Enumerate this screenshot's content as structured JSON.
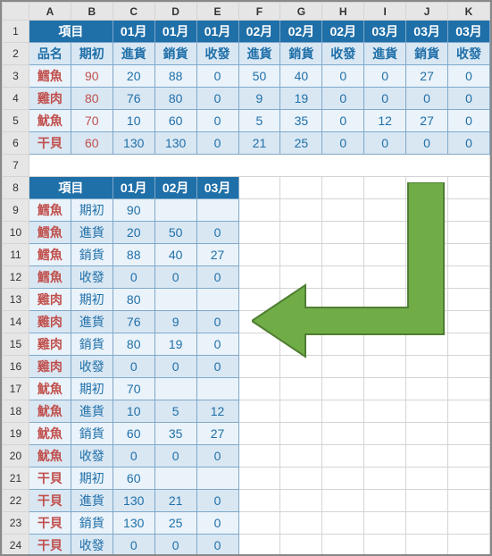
{
  "cols": [
    "A",
    "B",
    "C",
    "D",
    "E",
    "F",
    "G",
    "H",
    "I",
    "J",
    "K"
  ],
  "rows": [
    "1",
    "2",
    "3",
    "4",
    "5",
    "6",
    "7",
    "8",
    "9",
    "10",
    "11",
    "12",
    "13",
    "14",
    "15",
    "16",
    "17",
    "18",
    "19",
    "20",
    "21",
    "22",
    "23",
    "24"
  ],
  "top": {
    "h1": {
      "item": "項目",
      "m1": "01月",
      "m2": "01月",
      "m3": "01月",
      "m4": "02月",
      "m5": "02月",
      "m6": "02月",
      "m7": "03月",
      "m8": "03月",
      "m9": "03月"
    },
    "h2": {
      "c1": "品名",
      "c2": "期初",
      "c3": "進貨",
      "c4": "銷貨",
      "c5": "收發",
      "c6": "進貨",
      "c7": "銷貨",
      "c8": "收發",
      "c9": "進貨",
      "c10": "銷貨",
      "c11": "收發"
    },
    "r": [
      {
        "n": "鱈魚",
        "i": "90",
        "v": [
          "20",
          "88",
          "0",
          "50",
          "40",
          "0",
          "0",
          "27",
          "0"
        ]
      },
      {
        "n": "雞肉",
        "i": "80",
        "v": [
          "76",
          "80",
          "0",
          "9",
          "19",
          "0",
          "0",
          "0",
          "0"
        ]
      },
      {
        "n": "魷魚",
        "i": "70",
        "v": [
          "10",
          "60",
          "0",
          "5",
          "35",
          "0",
          "12",
          "27",
          "0"
        ]
      },
      {
        "n": "干貝",
        "i": "60",
        "v": [
          "130",
          "130",
          "0",
          "21",
          "25",
          "0",
          "0",
          "0",
          "0"
        ]
      }
    ]
  },
  "small": {
    "h": {
      "item": "項目",
      "m1": "01月",
      "m2": "02月",
      "m3": "03月"
    },
    "r": [
      {
        "n": "鱈魚",
        "t": "期初",
        "v": [
          "90",
          "",
          ""
        ]
      },
      {
        "n": "鱈魚",
        "t": "進貨",
        "v": [
          "20",
          "50",
          "0"
        ]
      },
      {
        "n": "鱈魚",
        "t": "銷貨",
        "v": [
          "88",
          "40",
          "27"
        ]
      },
      {
        "n": "鱈魚",
        "t": "收發",
        "v": [
          "0",
          "0",
          "0"
        ]
      },
      {
        "n": "雞肉",
        "t": "期初",
        "v": [
          "80",
          "",
          ""
        ]
      },
      {
        "n": "雞肉",
        "t": "進貨",
        "v": [
          "76",
          "9",
          "0"
        ]
      },
      {
        "n": "雞肉",
        "t": "銷貨",
        "v": [
          "80",
          "19",
          "0"
        ]
      },
      {
        "n": "雞肉",
        "t": "收發",
        "v": [
          "0",
          "0",
          "0"
        ]
      },
      {
        "n": "魷魚",
        "t": "期初",
        "v": [
          "70",
          "",
          ""
        ]
      },
      {
        "n": "魷魚",
        "t": "進貨",
        "v": [
          "10",
          "5",
          "12"
        ]
      },
      {
        "n": "魷魚",
        "t": "銷貨",
        "v": [
          "60",
          "35",
          "27"
        ]
      },
      {
        "n": "魷魚",
        "t": "收發",
        "v": [
          "0",
          "0",
          "0"
        ]
      },
      {
        "n": "干貝",
        "t": "期初",
        "v": [
          "60",
          "",
          ""
        ]
      },
      {
        "n": "干貝",
        "t": "進貨",
        "v": [
          "130",
          "21",
          "0"
        ]
      },
      {
        "n": "干貝",
        "t": "銷貨",
        "v": [
          "130",
          "25",
          "0"
        ]
      },
      {
        "n": "干貝",
        "t": "收發",
        "v": [
          "0",
          "0",
          "0"
        ]
      }
    ]
  }
}
